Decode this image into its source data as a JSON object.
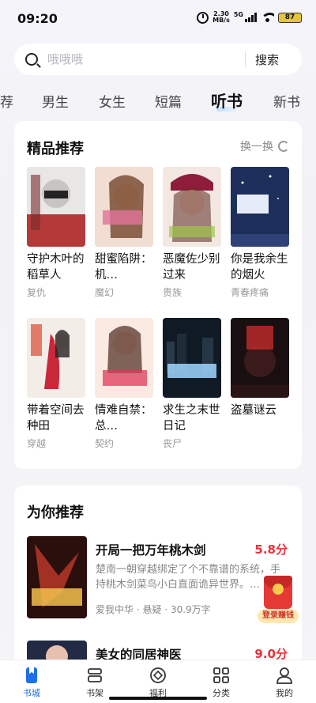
{
  "status": {
    "time": "09:20",
    "net_speed_value": "2.30",
    "net_speed_unit": "MB/s",
    "network": "5G",
    "battery": "87"
  },
  "search": {
    "placeholder": "哦哦哦",
    "button": "搜索"
  },
  "tabs": [
    {
      "label": "荐"
    },
    {
      "label": "男生"
    },
    {
      "label": "女生"
    },
    {
      "label": "短篇"
    },
    {
      "label": "听书",
      "active": true
    },
    {
      "label": "新书"
    }
  ],
  "featured": {
    "title": "精品推荐",
    "refresh_label": "换一换",
    "books": [
      {
        "title": "守护木叶的稻草人",
        "tag": "复仇"
      },
      {
        "title": "甜蜜陷阱：机…",
        "tag": "魔幻"
      },
      {
        "title": "恶魔佐少别过来",
        "tag": "贵族"
      },
      {
        "title": "你是我余生的烟火",
        "tag": "青春疼痛"
      },
      {
        "title": "带着空间去种田",
        "tag": "穿越"
      },
      {
        "title": "情难自禁：总…",
        "tag": "契约"
      },
      {
        "title": "求生之末世日记",
        "tag": "丧尸"
      },
      {
        "title": "盗墓谜云",
        "tag": ""
      }
    ]
  },
  "recommend": {
    "title": "为你推荐",
    "items": [
      {
        "title": "开局一把万年桃木剑",
        "score": "5.8分",
        "desc": "楚南一朝穿越绑定了个不靠谱的系统，手持桃木剑菜鸟小白直面诡异世界。…",
        "author": "爱我中华",
        "genre": "悬疑",
        "count": "30.9万字"
      },
      {
        "title": "美女的同居神医",
        "score": "9.0分"
      }
    ]
  },
  "red_packet": {
    "label": "登录赚钱"
  },
  "bottom_nav": [
    {
      "label": "书城",
      "active": true
    },
    {
      "label": "书架"
    },
    {
      "label": "福利"
    },
    {
      "label": "分类"
    },
    {
      "label": "我的"
    }
  ],
  "colors": {
    "accent": "#1e6fe8",
    "score": "#e8323c"
  }
}
